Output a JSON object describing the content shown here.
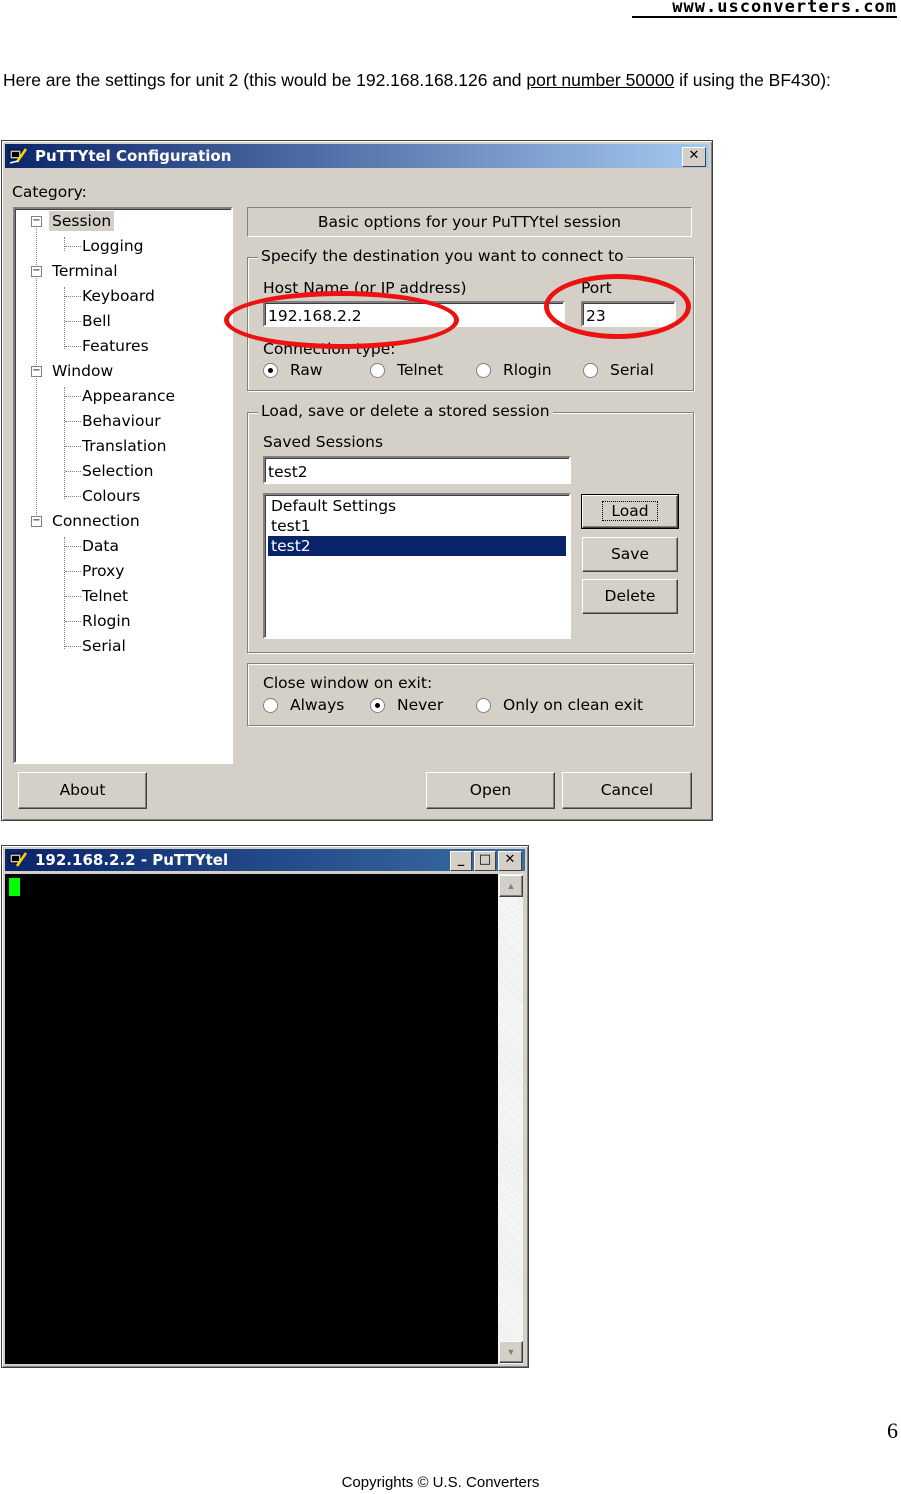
{
  "page": {
    "site_url": "www.usconverters.com",
    "intro_before": "Here are the settings for unit 2 (this would be 192.168.168.126 and ",
    "intro_link": "port number 50000",
    "intro_after": " if using the BF430):",
    "page_number": "6",
    "copyright": "Copyrights © U.S. Converters"
  },
  "config_dialog": {
    "title": "PuTTYtel Configuration",
    "category_label": "Category:",
    "tree": [
      {
        "label": "Session",
        "level": 0,
        "expander": "-",
        "selected": true
      },
      {
        "label": "Logging",
        "level": 1
      },
      {
        "label": "Terminal",
        "level": 0,
        "expander": "-"
      },
      {
        "label": "Keyboard",
        "level": 1
      },
      {
        "label": "Bell",
        "level": 1
      },
      {
        "label": "Features",
        "level": 1
      },
      {
        "label": "Window",
        "level": 0,
        "expander": "-"
      },
      {
        "label": "Appearance",
        "level": 1
      },
      {
        "label": "Behaviour",
        "level": 1
      },
      {
        "label": "Translation",
        "level": 1
      },
      {
        "label": "Selection",
        "level": 1
      },
      {
        "label": "Colours",
        "level": 1
      },
      {
        "label": "Connection",
        "level": 0,
        "expander": "-"
      },
      {
        "label": "Data",
        "level": 1
      },
      {
        "label": "Proxy",
        "level": 1
      },
      {
        "label": "Telnet",
        "level": 1
      },
      {
        "label": "Rlogin",
        "level": 1
      },
      {
        "label": "Serial",
        "level": 1
      }
    ],
    "panel_header": "Basic options for your PuTTYtel session",
    "destination": {
      "legend": "Specify the destination you want to connect to",
      "host_label": "Host Name (or IP address)",
      "host_value": "192.168.2.2",
      "port_label": "Port",
      "port_value": "23",
      "conn_type_label": "Connection type:",
      "conn_types": [
        {
          "label": "Raw",
          "checked": true
        },
        {
          "label": "Telnet",
          "checked": false
        },
        {
          "label": "Rlogin",
          "checked": false
        },
        {
          "label": "Serial",
          "checked": false
        }
      ]
    },
    "sessions": {
      "legend": "Load, save or delete a stored session",
      "saved_label": "Saved Sessions",
      "saved_value": "test2",
      "list": [
        {
          "label": "Default Settings",
          "selected": false
        },
        {
          "label": "test1",
          "selected": false
        },
        {
          "label": "test2",
          "selected": true
        }
      ],
      "load_label": "Load",
      "save_label": "Save",
      "delete_label": "Delete"
    },
    "close_on_exit": {
      "label": "Close window on exit:",
      "options": [
        {
          "label": "Always",
          "checked": false
        },
        {
          "label": "Never",
          "checked": true
        },
        {
          "label": "Only on clean exit",
          "checked": false
        }
      ]
    },
    "about_label": "About",
    "open_label": "Open",
    "cancel_label": "Cancel",
    "highlight_color": "#ee1111"
  },
  "terminal_window": {
    "title": "192.168.2.2 - PuTTYtel",
    "minimize_icon": "minimize-icon",
    "maximize_icon": "maximize-icon",
    "close_icon": "close-icon",
    "background": "#000000",
    "cursor_color": "#00ff00"
  }
}
